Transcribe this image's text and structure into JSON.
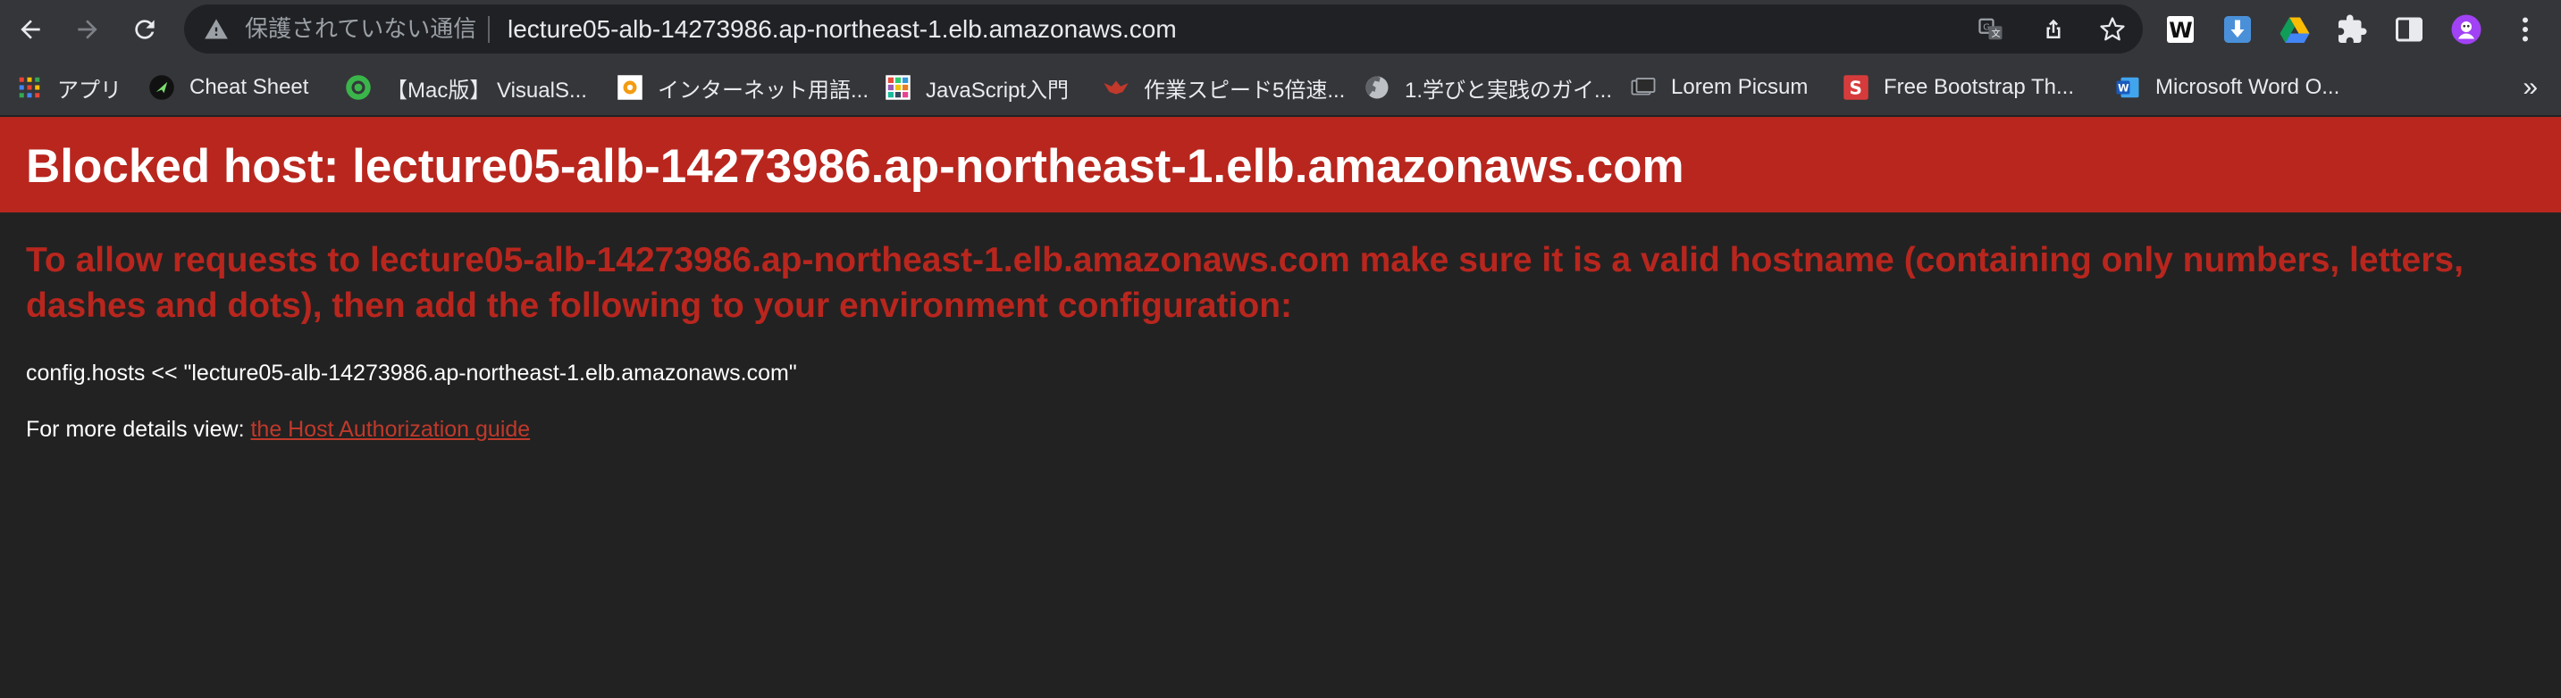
{
  "browser": {
    "omnibox": {
      "security_text": "保護されていない通信",
      "url": "lecture05-alb-14273986.ap-northeast-1.elb.amazonaws.com"
    },
    "avatar_color": "#a142f4"
  },
  "bookmarks": [
    {
      "label": "アプリ",
      "icon": "apps-grid-icon"
    },
    {
      "label": "Cheat Sheet",
      "icon": "cheat-sheet-icon"
    },
    {
      "label": "【Mac版】 VisualS...",
      "icon": "visual-studio-icon"
    },
    {
      "label": "インターネット用語...",
      "icon": "internet-terms-icon"
    },
    {
      "label": "JavaScript入門",
      "icon": "javascript-grid-icon"
    },
    {
      "label": "作業スピード5倍速...",
      "icon": "speed-bird-icon"
    },
    {
      "label": "1.学びと実践のガイ...",
      "icon": "globe-icon"
    },
    {
      "label": "Lorem Picsum",
      "icon": "picsum-icon"
    },
    {
      "label": "Free Bootstrap Th...",
      "icon": "bootstrap-s-icon"
    },
    {
      "label": "Microsoft Word O...",
      "icon": "word-icon"
    }
  ],
  "bookmarks_more": "»",
  "page": {
    "title": "Blocked host: lecture05-alb-14273986.ap-northeast-1.elb.amazonaws.com",
    "message": "To allow requests to lecture05-alb-14273986.ap-northeast-1.elb.amazonaws.com make sure it is a valid hostname (containing only numbers, letters, dashes and dots), then add the following to your environment configuration:",
    "code": "config.hosts << \"lecture05-alb-14273986.ap-northeast-1.elb.amazonaws.com\"",
    "more_prefix": "For more details view: ",
    "guide_link": "the Host Authorization guide",
    "header_color": "#b8261e"
  }
}
